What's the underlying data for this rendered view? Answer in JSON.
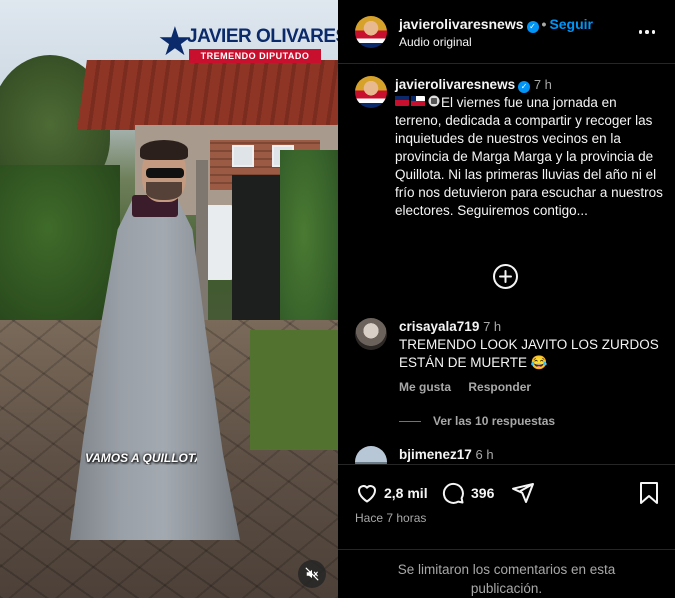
{
  "video": {
    "logo_name": "JAVIER OLIVARES",
    "logo_sub": "TREMENDO DIPUTADO",
    "caption": "VAMOS A QUILLOTA"
  },
  "header": {
    "username": "javierolivaresnews",
    "follow_label": "Seguir",
    "audio_label": "Audio original"
  },
  "caption": {
    "username": "javierolivaresnews",
    "time": "7 h",
    "text": "El viernes fue una jornada en terreno, dedicada a compartir y recoger las inquietudes de nuestros vecinos en la provincia de Marga Marga y la provincia de Quillota. Ni las primeras lluvias del año ni el frío nos detuvieron para escuchar a nuestros electores. Seguiremos contigo..."
  },
  "comments": [
    {
      "username": "crisayala719",
      "time": "7 h",
      "text": "TREMENDO LOOK JAVITO LOS ZURDOS ESTÁN DE MUERTE 😂",
      "like_label": "Me gusta",
      "reply_label": "Responder",
      "view_replies": "Ver las 10 respuestas"
    },
    {
      "username": "bjimenez17",
      "time": "6 h"
    }
  ],
  "footer": {
    "likes": "2,8 mil",
    "comments_count": "396",
    "posted": "Hace 7 horas",
    "limited_text": "Se limitaron los comentarios en esta publicación."
  },
  "colors": {
    "background": "#000000",
    "link": "#0095f6",
    "muted": "#a8a8a8"
  }
}
